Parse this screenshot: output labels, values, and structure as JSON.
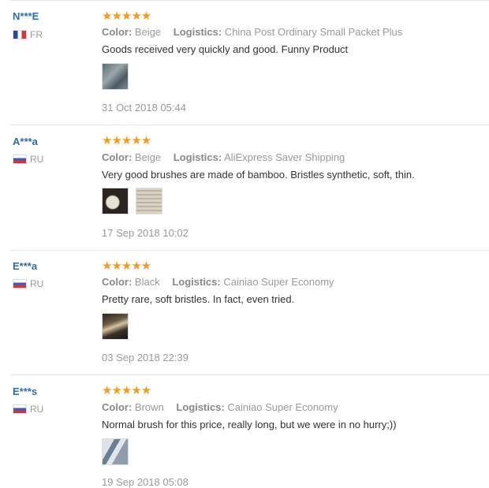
{
  "reviews": [
    {
      "user": "N***E",
      "country_flag": "fr-flag",
      "country": "FR",
      "stars": "★★★★★",
      "color_label": "Color:",
      "color": "Beige",
      "logistics_label": "Logistics:",
      "logistics": "China Post Ordinary Small Packet Plus",
      "text": "Goods received very quickly and good. Funny Product",
      "date": "31 Oct 2018 05:44"
    },
    {
      "user": "A***a",
      "country_flag": "ru-flag",
      "country": "RU",
      "stars": "★★★★★",
      "color_label": "Color:",
      "color": "Beige",
      "logistics_label": "Logistics:",
      "logistics": "AliExpress Saver Shipping",
      "text": "Very good brushes are made of bamboo. Bristles synthetic, soft, thin.",
      "date": "17 Sep 2018 10:02"
    },
    {
      "user": "E***a",
      "country_flag": "ru-flag",
      "country": "RU",
      "stars": "★★★★★",
      "color_label": "Color:",
      "color": "Black",
      "logistics_label": "Logistics:",
      "logistics": "Cainiao Super Economy",
      "text": "Pretty rare, soft bristles. In fact, even tried.",
      "date": "03 Sep 2018 22:39"
    },
    {
      "user": "E***s",
      "country_flag": "ru-flag",
      "country": "RU",
      "stars": "★★★★★",
      "color_label": "Color:",
      "color": "Brown",
      "logistics_label": "Logistics:",
      "logistics": "Cainiao Super Economy",
      "text": "Normal brush for this price, really long, but we were in no hurry;))",
      "date": "19 Sep 2018 05:08"
    }
  ],
  "colors": {
    "username": "#2a6cb3",
    "stars": "#f59b1e",
    "muted": "#999999",
    "body_text": "#333333"
  }
}
